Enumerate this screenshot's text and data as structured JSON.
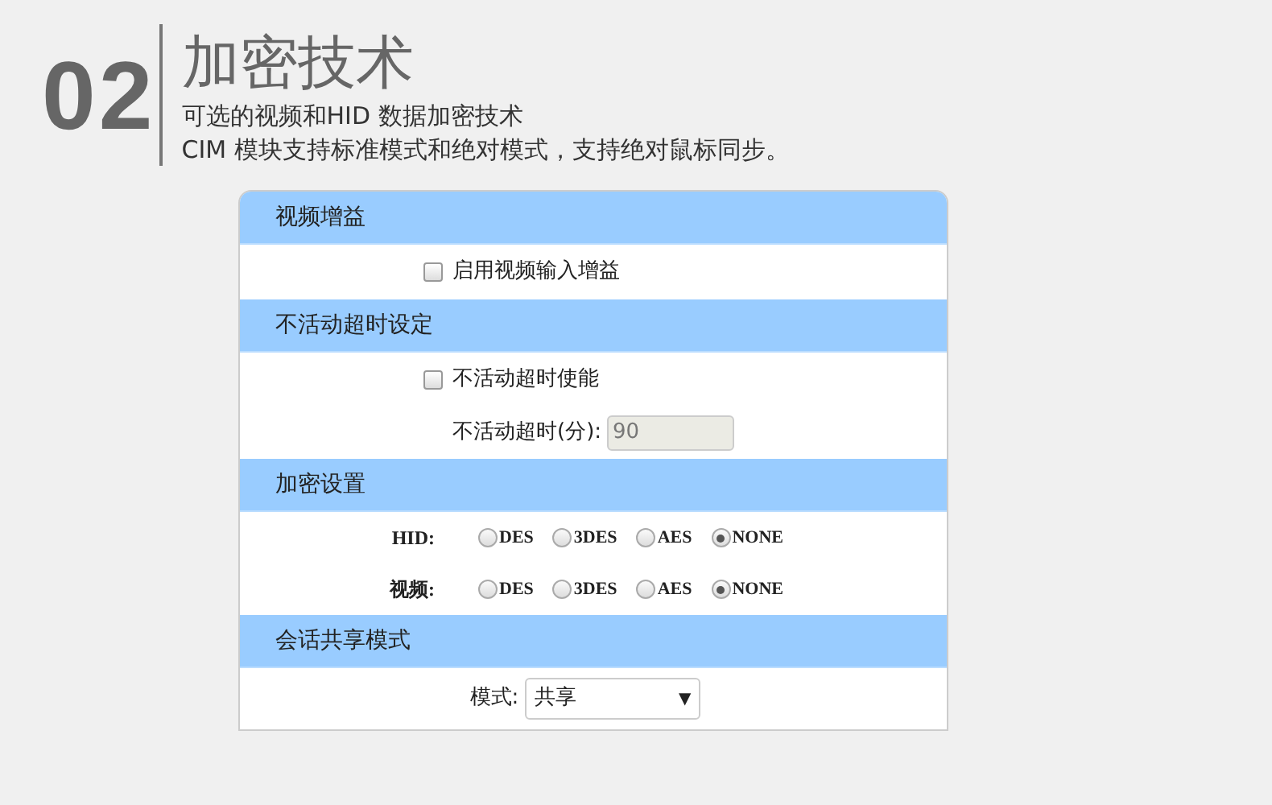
{
  "header": {
    "number": "02",
    "title": "加密技术",
    "lines": [
      "可选的视频和HID 数据加密技术",
      "CIM 模块支持标准模式和绝对模式，支持绝对鼠标同步。"
    ]
  },
  "sections": [
    {
      "title": "视频增益",
      "rows": [
        {
          "kind": "checkbox",
          "label": "启用视频输入增益",
          "checked": false
        }
      ]
    },
    {
      "title": "不活动超时设定",
      "rows": [
        {
          "kind": "checkbox",
          "label": "不活动超时使能",
          "checked": false
        },
        {
          "kind": "field",
          "label": "不活动超时(分):",
          "value": "90",
          "disabled": true
        }
      ]
    },
    {
      "title": "加密设置",
      "rows": [
        {
          "kind": "radio",
          "label": "HID:",
          "options": [
            {
              "label": "DES",
              "selected": false
            },
            {
              "label": "3DES",
              "selected": false
            },
            {
              "label": "AES",
              "selected": false
            },
            {
              "label": "NONE",
              "selected": true
            }
          ]
        },
        {
          "kind": "radio",
          "label": "视频:",
          "options": [
            {
              "label": "DES",
              "selected": false
            },
            {
              "label": "3DES",
              "selected": false
            },
            {
              "label": "AES",
              "selected": false
            },
            {
              "label": "NONE",
              "selected": true
            }
          ]
        }
      ]
    },
    {
      "title": "会话共享模式",
      "rows": [
        {
          "kind": "select",
          "label": "模式:",
          "value": "共享",
          "arrow": "▼"
        }
      ]
    }
  ]
}
